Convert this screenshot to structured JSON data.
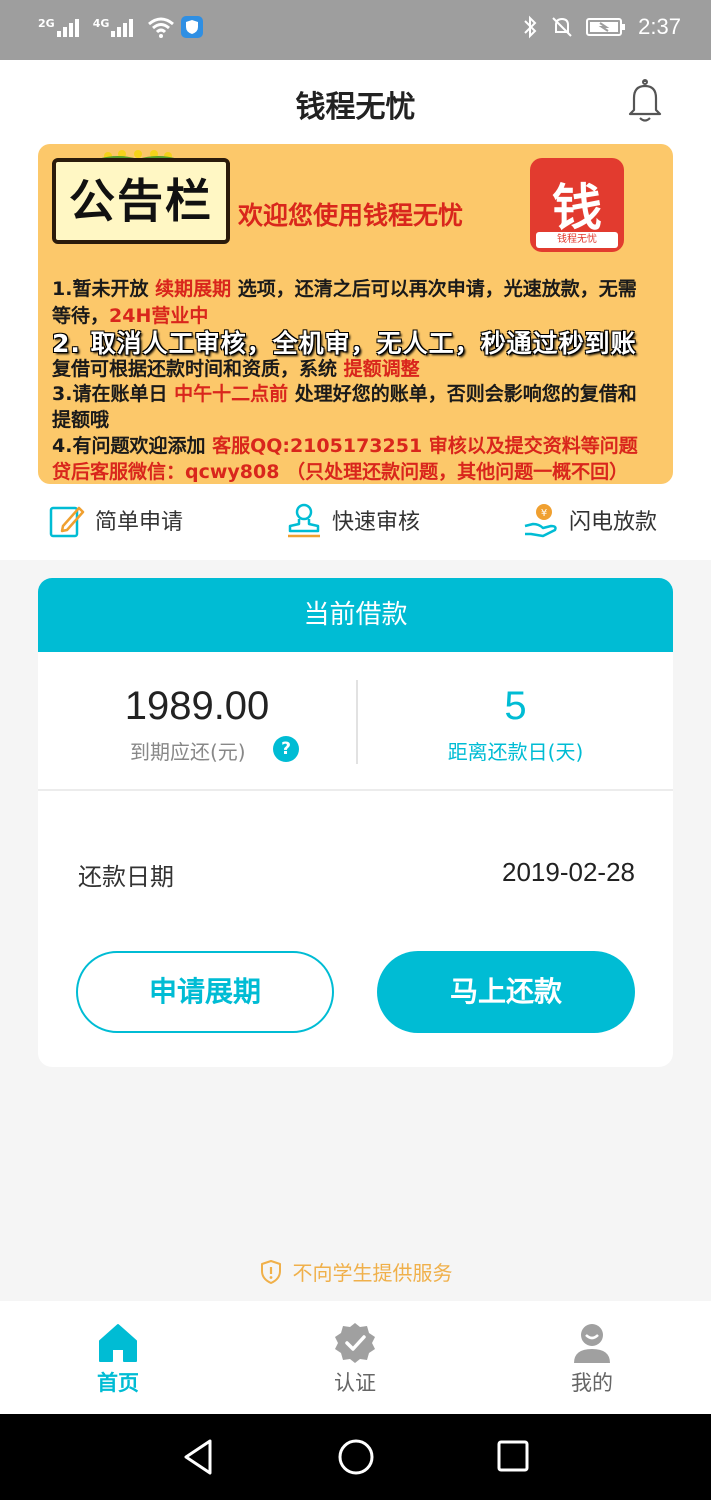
{
  "status_bar": {
    "signal_1": "2G",
    "signal_2": "4G",
    "time": "2:37",
    "icons": [
      "signal-icon",
      "signal-icon",
      "wifi-icon",
      "shield-icon",
      "bluetooth-icon",
      "mute-icon",
      "battery-icon"
    ]
  },
  "header": {
    "title": "钱程无忧",
    "icon": "bell-icon"
  },
  "banner": {
    "board_text": "公告栏",
    "welcome": "欢迎您使用钱程无忧",
    "logo_char": "钱",
    "logo_sub": "钱程无忧",
    "lines": [
      {
        "a": "1.暂未开放 ",
        "b": "续期展期",
        "c": " 选项，还清之后可以再次申请，光速放款，无需"
      },
      {
        "a": "等待，",
        "b": "24H营业中",
        "c": ""
      },
      {
        "a": "2. 取消人工审核，全机审，无人工，秒通过秒到账",
        "b": "",
        "c": ""
      },
      {
        "a": "复借可根据还款时间和资质，系统 ",
        "b": "提额调整",
        "c": ""
      },
      {
        "a": "3.请在账单日 ",
        "b": "中午十二点前",
        "c": " 处理好您的账单，否则会影响您的复借和"
      },
      {
        "a": "提额哦",
        "b": "",
        "c": ""
      },
      {
        "a": "4.有问题欢迎添加 ",
        "b": "客服QQ:2105173251  审核以及提交资料等问题",
        "c": ""
      },
      {
        "a": "",
        "b": "贷后客服微信：qcwy808 （只处理还款问题，其他问题一概不回）",
        "c": ""
      }
    ]
  },
  "features": [
    {
      "label": "简单申请",
      "icon": "edit-icon"
    },
    {
      "label": "快速审核",
      "icon": "stamp-icon"
    },
    {
      "label": "闪电放款",
      "icon": "money-hand-icon"
    }
  ],
  "loan": {
    "title": "当前借款",
    "amount": "1989.00",
    "amount_label": "到期应还(元)",
    "help": "?",
    "days": "5",
    "days_label": "距离还款日(天)",
    "date_label": "还款日期",
    "date_value": "2019-02-28",
    "extend_button": "申请展期",
    "repay_button": "马上还款"
  },
  "notice": {
    "text": "不向学生提供服务",
    "icon": "shield-alert-icon"
  },
  "bottom_nav": [
    {
      "label": "首页",
      "icon": "home-icon",
      "active": true
    },
    {
      "label": "认证",
      "icon": "verified-icon",
      "active": false
    },
    {
      "label": "我的",
      "icon": "user-icon",
      "active": false
    }
  ],
  "colors": {
    "accent": "#00bcd4",
    "banner_bg": "#fcc86a",
    "highlight_red": "#d9261c",
    "notice": "#f0b04a",
    "inactive_nav": "#9e9e9e"
  }
}
